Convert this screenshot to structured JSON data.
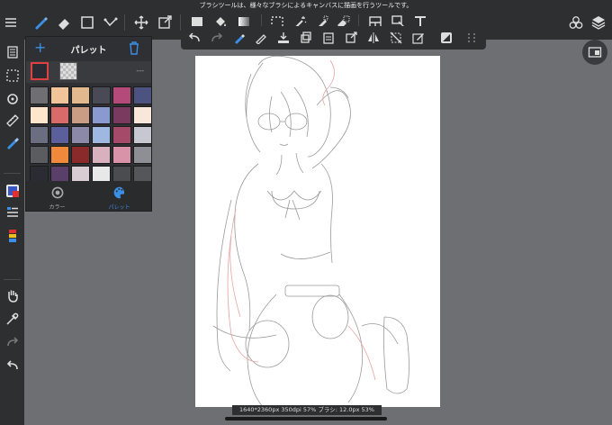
{
  "hint_text": "ブラシツールは、様々なブラシによるキャンバスに描画を行うツールです。",
  "palette": {
    "title": "パレット",
    "more": "---",
    "tab_color": "カラー",
    "tab_palette": "パレット",
    "colors": [
      "#6f6f73",
      "#f2c49a",
      "#e2b88f",
      "#4a4a56",
      "#b34a7a",
      "#4d5380",
      "#fde6cc",
      "#d86a6a",
      "#c99c84",
      "#8a99d0",
      "#7a3a60",
      "#f9e8da",
      "#6b6e80",
      "#5b5f9c",
      "#8b88a8",
      "#9fb8e2",
      "#a64a6a",
      "#c7c7d2",
      "#5a5c60",
      "#ef8a3c",
      "#8a2a2a",
      "#d9b0bd",
      "#d893a8",
      "#8e8f94",
      "#2a2b33",
      "#5a3f6a",
      "#d9ccd2",
      "#e8e8e8",
      "#4b4c50",
      "#55565a"
    ]
  },
  "status": "1640*2360px 350dpi 57% ブラシ: 12.0px 53%",
  "accent": "#3b8fe6"
}
